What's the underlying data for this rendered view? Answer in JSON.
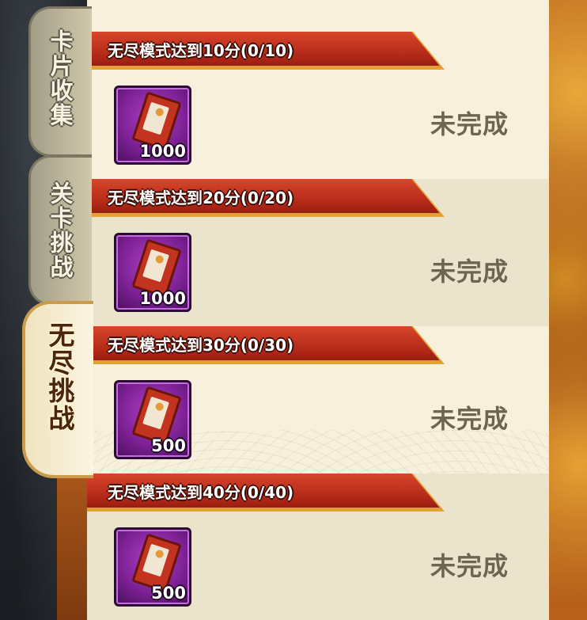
{
  "tabs": [
    {
      "label": "卡片收集",
      "active": false
    },
    {
      "label": "关卡挑战",
      "active": false
    },
    {
      "label": "无尽挑战",
      "active": true
    }
  ],
  "quests": [
    {
      "title": "无尽模式达到10分(0/10)",
      "reward_qty": "1000",
      "status": "未完成",
      "reward_icon": "red-card-icon"
    },
    {
      "title": "无尽模式达到20分(0/20)",
      "reward_qty": "1000",
      "status": "未完成",
      "reward_icon": "red-card-icon"
    },
    {
      "title": "无尽模式达到30分(0/30)",
      "reward_qty": "500",
      "status": "未完成",
      "reward_icon": "red-card-icon"
    },
    {
      "title": "无尽模式达到40分(0/40)",
      "reward_qty": "500",
      "status": "未完成",
      "reward_icon": "red-card-icon"
    }
  ],
  "colors": {
    "banner_red": "#b02716",
    "panel_cream": "#f6f0dc",
    "item_purple": "#7a1f92",
    "status_text": "#6e6450",
    "frame_gold": "#d08a24"
  }
}
